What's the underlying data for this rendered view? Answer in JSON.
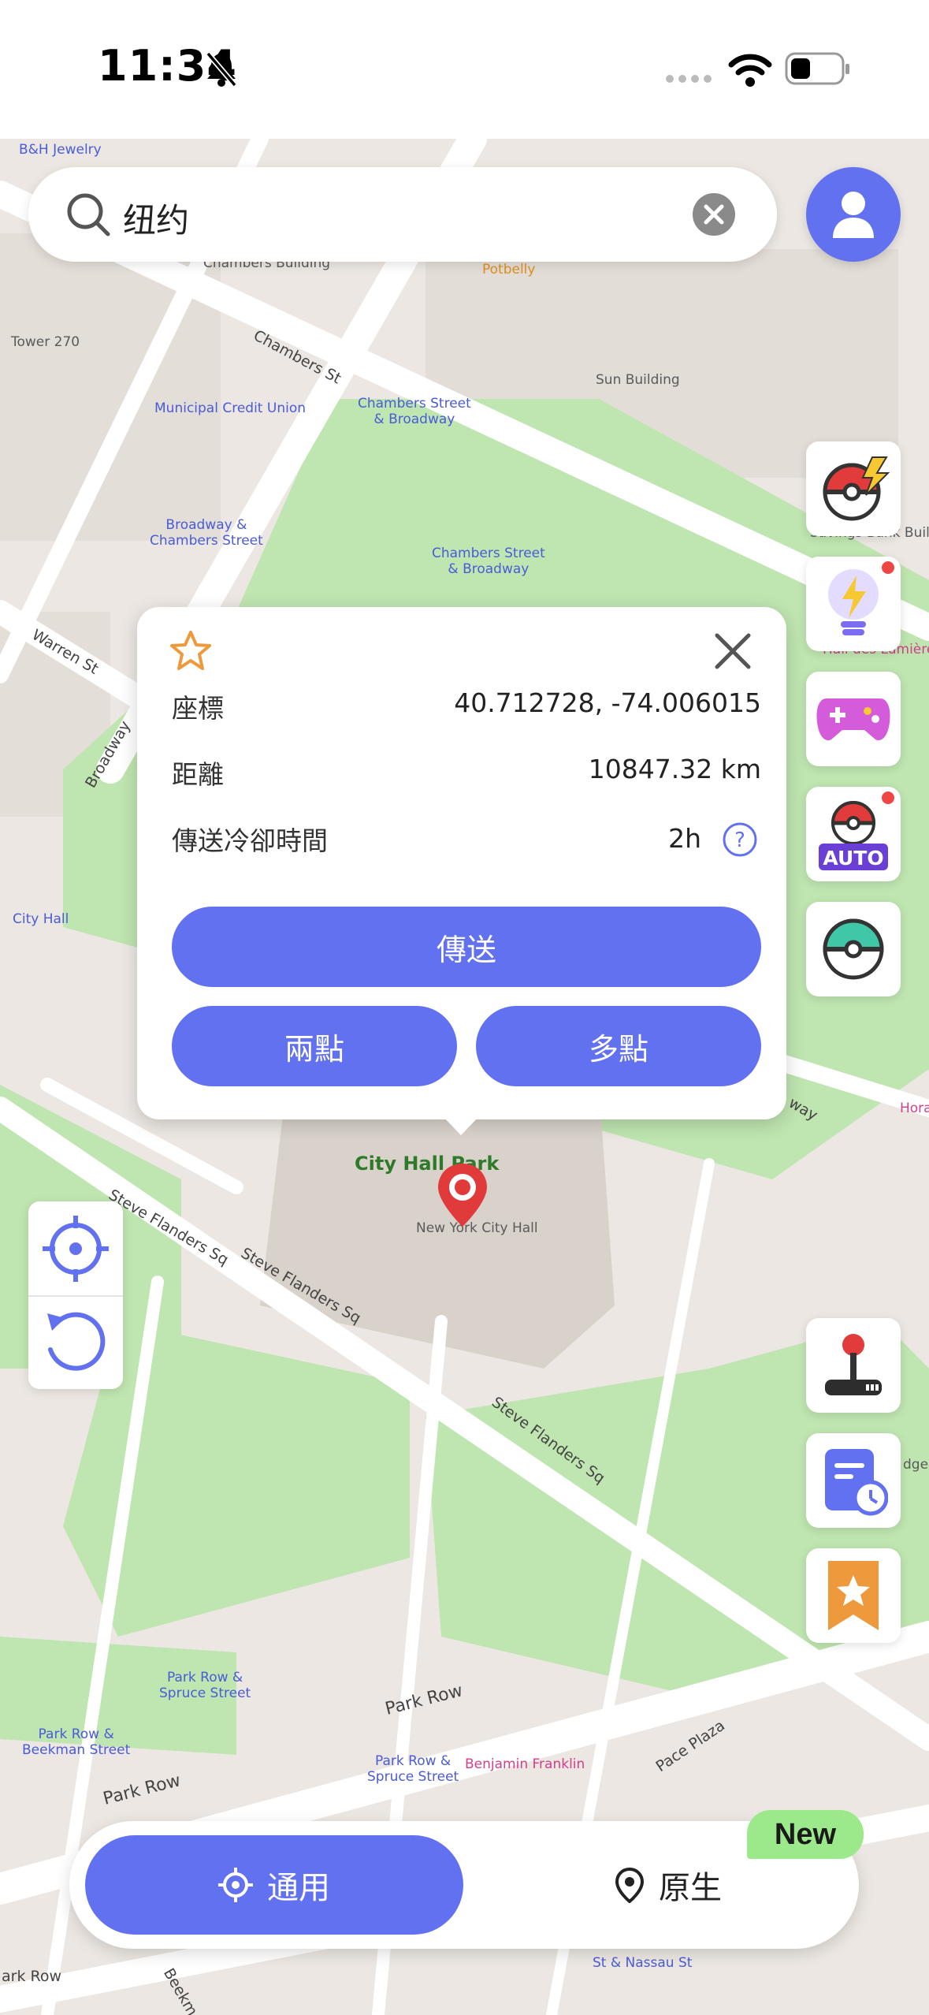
{
  "status_bar": {
    "time": "11:34",
    "icons": [
      "bell-slash-icon",
      "signal-icon",
      "wifi-icon",
      "battery-icon"
    ]
  },
  "search": {
    "query": "纽约",
    "icons": [
      "search-icon",
      "clear-icon"
    ]
  },
  "map_labels": {
    "bh_jewelry": "B&H Jewelry",
    "chambers_building": "Chambers Building",
    "potbelly": "Potbelly",
    "tower_270": "Tower 270",
    "chambers_st": "Chambers St",
    "municipal_credit_union": "Municipal Credit Union",
    "chambers_broadway_1": "Chambers Street\n& Broadway",
    "sun_building": "Sun Building",
    "broadway_chambers": "Broadway &\nChambers Street",
    "chambers_broadway_2": "Chambers Street\n& Broadway",
    "savings_bank": "Savings Bank Buildi",
    "warren_st": "Warren St",
    "broadway": "Broadway",
    "city_hall": "City Hall",
    "hall_des_lumieres": "Hall des Lumières",
    "city_hall_park": "City Hall Park",
    "new_york_city_hall": "New York City Hall",
    "steve_flanders_1": "Steve Flanders Sq",
    "steve_flanders_2": "Steve Flanders Sq",
    "steve_flanders_3": "Steve Flanders Sq",
    "park_row_spruce_1": "Park Row &\nSpruce Street",
    "park_row_beekman": "Park Row &\nBeekman Street",
    "park_row_1": "Park Row",
    "park_row_2": "Park Row",
    "park_row_spruce_2": "Park Row &\nSpruce Street",
    "benjamin_franklin": "Benjamin Franklin",
    "pace_plaza": "Pace Plaza",
    "nassau": "St & Nassau St",
    "beekman": "Beekm",
    "hora": "Hora",
    "edge": "dge-",
    "park_row_3": "ark Row",
    "way": "way"
  },
  "side_buttons": {
    "top": [
      {
        "icon": "pokeball-lightning-icon",
        "badge": false
      },
      {
        "icon": "lightbulb-icon",
        "badge": true
      },
      {
        "icon": "gamepad-icon",
        "badge": false
      },
      {
        "icon": "pokeball-auto-icon",
        "label": "AUTO",
        "badge": true
      },
      {
        "icon": "pokeball-teal-icon",
        "badge": false
      }
    ],
    "bottom": [
      {
        "icon": "joystick-icon"
      },
      {
        "icon": "history-list-icon"
      },
      {
        "icon": "favorite-bookmark-icon"
      }
    ]
  },
  "popup": {
    "coord_label": "座標",
    "coord_value": "40.712728, -74.006015",
    "distance_label": "距離",
    "distance_value": "10847.32 km",
    "cooldown_label": "傳送冷卻時間",
    "cooldown_value": "2h",
    "teleport_button": "傳送",
    "two_point_button": "兩點",
    "multi_point_button": "多點"
  },
  "bottom_bar": {
    "general_label": "通用",
    "native_label": "原生",
    "new_badge": "New"
  },
  "colors": {
    "accent": "#6271ef",
    "pin_red": "#e03a3a",
    "new_badge": "#9be98a",
    "map_bg": "#ece7e2",
    "park_green": "#bfe5b0"
  }
}
